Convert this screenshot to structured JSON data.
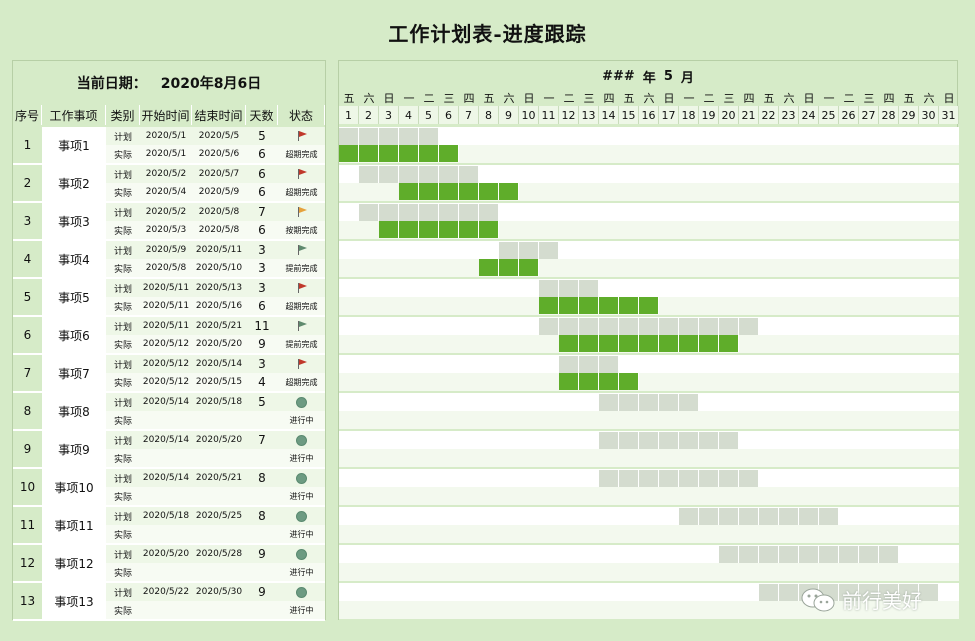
{
  "title": "工作计划表-进度跟踪",
  "current_date_label": "当前日期：",
  "current_date_value": "2020年8月6日",
  "month_header": {
    "year": "###",
    "year_unit": "年",
    "month": "5",
    "month_unit": "月"
  },
  "columns": [
    "序号",
    "工作事项",
    "类别",
    "开始时间",
    "结束时间",
    "天数",
    "状态"
  ],
  "type_labels": {
    "plan": "计划",
    "actual": "实际"
  },
  "weekdays": [
    "五",
    "六",
    "日",
    "一",
    "二",
    "三",
    "四",
    "五",
    "六",
    "日",
    "一",
    "二",
    "三",
    "四",
    "五",
    "六",
    "日",
    "一",
    "二",
    "三",
    "四",
    "五",
    "六",
    "日",
    "一",
    "二",
    "三",
    "四",
    "五",
    "六",
    "日"
  ],
  "dates": [
    "1",
    "2",
    "3",
    "4",
    "5",
    "6",
    "7",
    "8",
    "9",
    "10",
    "11",
    "12",
    "13",
    "14",
    "15",
    "16",
    "17",
    "18",
    "19",
    "20",
    "21",
    "22",
    "23",
    "24",
    "25",
    "26",
    "27",
    "28",
    "29",
    "30",
    "31"
  ],
  "colors": {
    "plan": "#d4dccf",
    "actual": "#5fad2a",
    "flag_red": "#c0392b",
    "flag_orange": "#e6a23c",
    "flag_green": "#5f8a6e",
    "dot": "#6d9b82"
  },
  "tasks": [
    {
      "seq": "1",
      "name": "事项1",
      "plan_start": "2020/5/1",
      "plan_end": "2020/5/5",
      "plan_days": "5",
      "actual_start": "2020/5/1",
      "actual_end": "2020/5/6",
      "actual_days": "6",
      "status": "超期完成",
      "icon": "red-flag-icon",
      "plan_range": [
        1,
        5
      ],
      "actual_range": [
        1,
        6
      ]
    },
    {
      "seq": "2",
      "name": "事项2",
      "plan_start": "2020/5/2",
      "plan_end": "2020/5/7",
      "plan_days": "6",
      "actual_start": "2020/5/4",
      "actual_end": "2020/5/9",
      "actual_days": "6",
      "status": "超期完成",
      "icon": "red-flag-icon",
      "plan_range": [
        2,
        7
      ],
      "actual_range": [
        4,
        9
      ]
    },
    {
      "seq": "3",
      "name": "事项3",
      "plan_start": "2020/5/2",
      "plan_end": "2020/5/8",
      "plan_days": "7",
      "actual_start": "2020/5/3",
      "actual_end": "2020/5/8",
      "actual_days": "6",
      "status": "按期完成",
      "icon": "orange-flag-icon",
      "plan_range": [
        2,
        8
      ],
      "actual_range": [
        3,
        8
      ]
    },
    {
      "seq": "4",
      "name": "事项4",
      "plan_start": "2020/5/9",
      "plan_end": "2020/5/11",
      "plan_days": "3",
      "actual_start": "2020/5/8",
      "actual_end": "2020/5/10",
      "actual_days": "3",
      "status": "提前完成",
      "icon": "green-flag-icon",
      "plan_range": [
        9,
        11
      ],
      "actual_range": [
        8,
        10
      ]
    },
    {
      "seq": "5",
      "name": "事项5",
      "plan_start": "2020/5/11",
      "plan_end": "2020/5/13",
      "plan_days": "3",
      "actual_start": "2020/5/11",
      "actual_end": "2020/5/16",
      "actual_days": "6",
      "status": "超期完成",
      "icon": "red-flag-icon",
      "plan_range": [
        11,
        13
      ],
      "actual_range": [
        11,
        16
      ]
    },
    {
      "seq": "6",
      "name": "事项6",
      "plan_start": "2020/5/11",
      "plan_end": "2020/5/21",
      "plan_days": "11",
      "actual_start": "2020/5/12",
      "actual_end": "2020/5/20",
      "actual_days": "9",
      "status": "提前完成",
      "icon": "green-flag-icon",
      "plan_range": [
        11,
        21
      ],
      "actual_range": [
        12,
        20
      ]
    },
    {
      "seq": "7",
      "name": "事项7",
      "plan_start": "2020/5/12",
      "plan_end": "2020/5/14",
      "plan_days": "3",
      "actual_start": "2020/5/12",
      "actual_end": "2020/5/15",
      "actual_days": "4",
      "status": "超期完成",
      "icon": "red-flag-icon",
      "plan_range": [
        12,
        14
      ],
      "actual_range": [
        12,
        15
      ]
    },
    {
      "seq": "8",
      "name": "事项8",
      "plan_start": "2020/5/14",
      "plan_end": "2020/5/18",
      "plan_days": "5",
      "actual_start": "",
      "actual_end": "",
      "actual_days": "",
      "status": "进行中",
      "icon": "in-progress-dot-icon",
      "plan_range": [
        14,
        18
      ],
      "actual_range": null
    },
    {
      "seq": "9",
      "name": "事项9",
      "plan_start": "2020/5/14",
      "plan_end": "2020/5/20",
      "plan_days": "7",
      "actual_start": "",
      "actual_end": "",
      "actual_days": "",
      "status": "进行中",
      "icon": "in-progress-dot-icon",
      "plan_range": [
        14,
        20
      ],
      "actual_range": null
    },
    {
      "seq": "10",
      "name": "事项10",
      "plan_start": "2020/5/14",
      "plan_end": "2020/5/21",
      "plan_days": "8",
      "actual_start": "",
      "actual_end": "",
      "actual_days": "",
      "status": "进行中",
      "icon": "in-progress-dot-icon",
      "plan_range": [
        14,
        21
      ],
      "actual_range": null
    },
    {
      "seq": "11",
      "name": "事项11",
      "plan_start": "2020/5/18",
      "plan_end": "2020/5/25",
      "plan_days": "8",
      "actual_start": "",
      "actual_end": "",
      "actual_days": "",
      "status": "进行中",
      "icon": "in-progress-dot-icon",
      "plan_range": [
        18,
        25
      ],
      "actual_range": null
    },
    {
      "seq": "12",
      "name": "事项12",
      "plan_start": "2020/5/20",
      "plan_end": "2020/5/28",
      "plan_days": "9",
      "actual_start": "",
      "actual_end": "",
      "actual_days": "",
      "status": "进行中",
      "icon": "in-progress-dot-icon",
      "plan_range": [
        20,
        28
      ],
      "actual_range": null
    },
    {
      "seq": "13",
      "name": "事项13",
      "plan_start": "2020/5/22",
      "plan_end": "2020/5/30",
      "plan_days": "9",
      "actual_start": "",
      "actual_end": "",
      "actual_days": "",
      "status": "进行中",
      "icon": "in-progress-dot-icon",
      "plan_range": [
        22,
        30
      ],
      "actual_range": null
    }
  ],
  "watermark": "前行美好"
}
